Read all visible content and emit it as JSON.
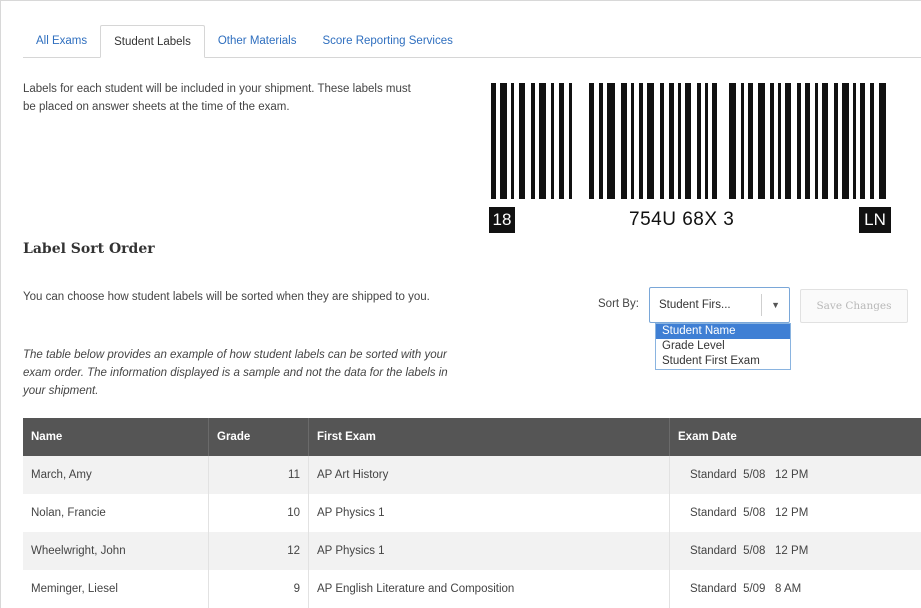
{
  "tabs": [
    {
      "label": "All Exams",
      "active": false
    },
    {
      "label": "Student Labels",
      "active": true
    },
    {
      "label": "Other Materials",
      "active": false
    },
    {
      "label": "Score Reporting Services",
      "active": false
    }
  ],
  "intro_text": "Labels for each student will be included in your shipment. These labels must be placed on answer sheets at the time of the exam.",
  "barcode": {
    "left_box": "18",
    "center_text": "754U 68X 3",
    "right_box": "LN"
  },
  "section_title": "Label Sort Order",
  "choose_text": "You can choose how student labels will be sorted when they are shipped to you.",
  "example_text": "The table below provides an example of how student labels can be sorted with your exam order. The information displayed is a sample and not the data for the labels in your shipment.",
  "sort": {
    "label": "Sort By:",
    "selected": "Student Firs...",
    "options": [
      "Student Name",
      "Grade Level",
      "Student First Exam"
    ],
    "highlighted_option": "Student Name",
    "save_label": "Save Changes"
  },
  "table": {
    "headers": [
      "Name",
      "Grade",
      "First Exam",
      "Exam Date"
    ],
    "rows": [
      {
        "name": "March, Amy",
        "grade": "11",
        "exam": "AP Art History",
        "date": "Standard  5/08   12 PM"
      },
      {
        "name": "Nolan, Francie",
        "grade": "10",
        "exam": "AP Physics 1",
        "date": "Standard  5/08   12 PM"
      },
      {
        "name": "Wheelwright, John",
        "grade": "12",
        "exam": "AP Physics 1",
        "date": "Standard  5/08   12 PM"
      },
      {
        "name": "Meminger, Liesel",
        "grade": "9",
        "exam": "AP English Literature and Composition",
        "date": "Standard  5/09   8 AM"
      }
    ]
  }
}
